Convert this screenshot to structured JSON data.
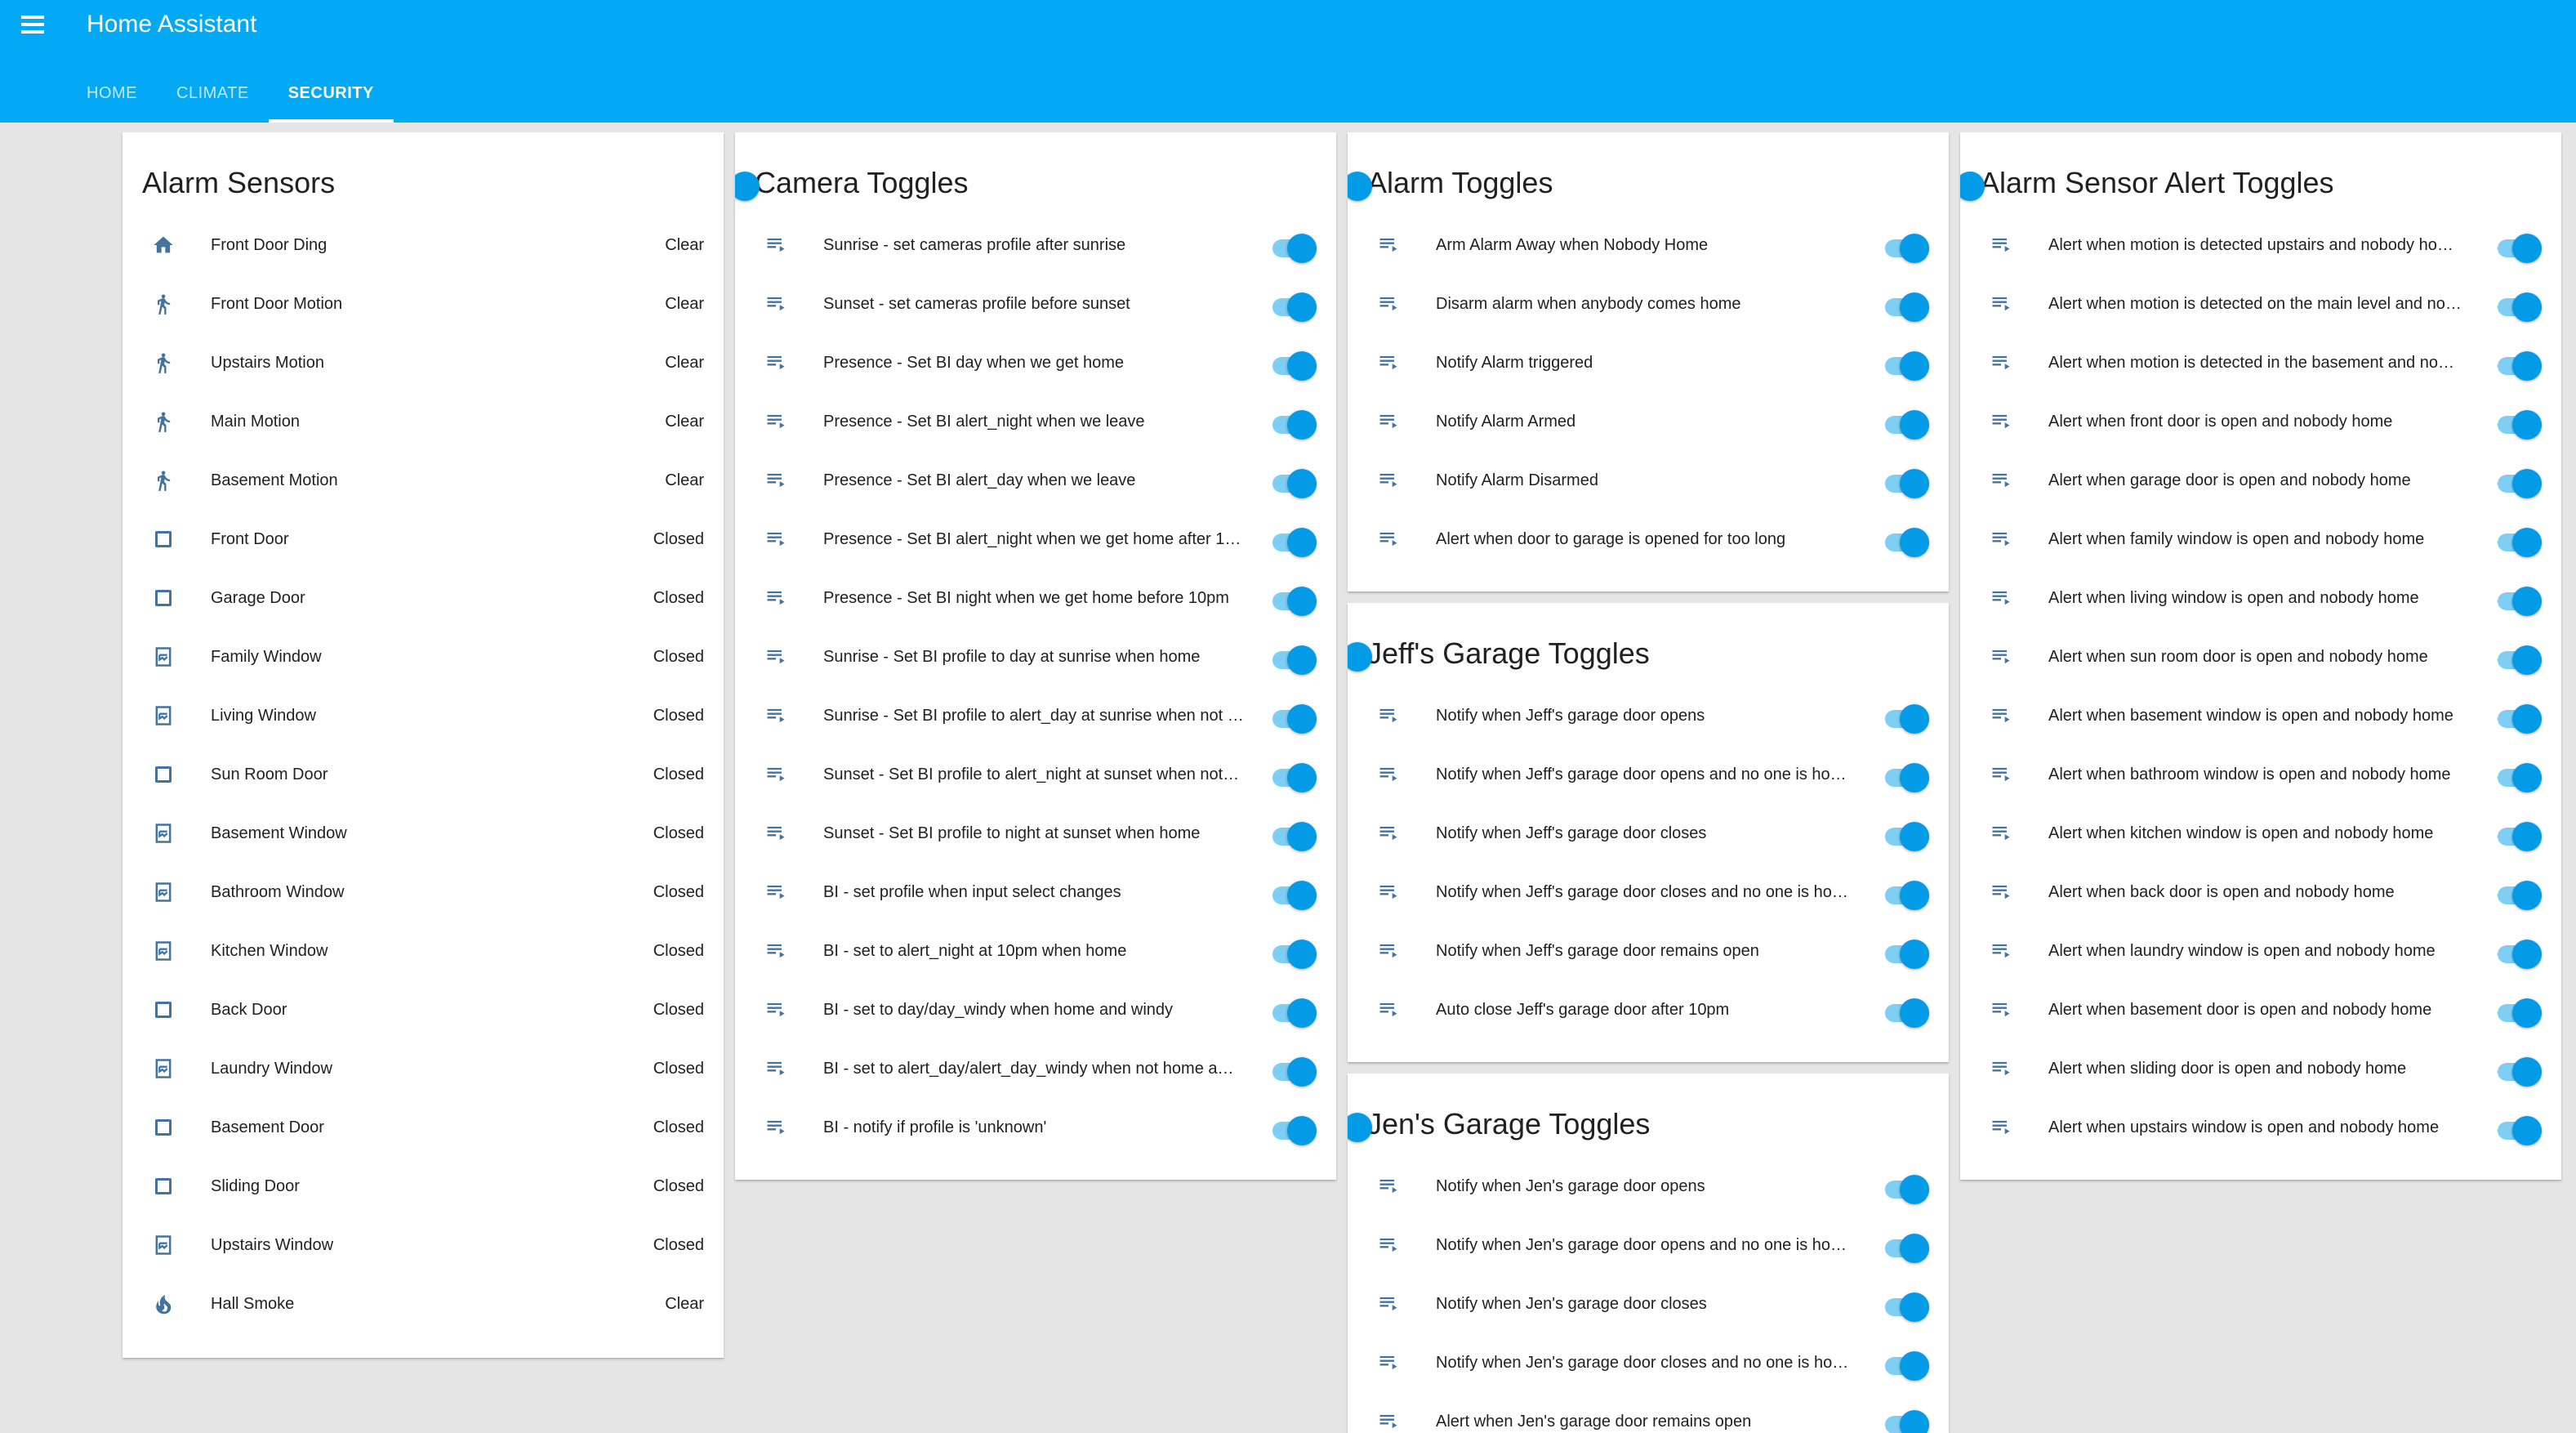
{
  "app": {
    "title": "Home Assistant"
  },
  "tabs": [
    "HOME",
    "CLIMATE",
    "SECURITY"
  ],
  "active_tab": "SECURITY",
  "colors": {
    "header": "#03a9f4",
    "icon": "#44739e",
    "toggle_on": "#039be5"
  },
  "cards": {
    "alarm_sensors": {
      "title": "Alarm Sensors",
      "rows": [
        {
          "icon": "home-icon",
          "name": "Front Door Ding",
          "state": "Clear"
        },
        {
          "icon": "walk-icon",
          "name": "Front Door Motion",
          "state": "Clear"
        },
        {
          "icon": "walk-icon",
          "name": "Upstairs Motion",
          "state": "Clear"
        },
        {
          "icon": "walk-icon",
          "name": "Main Motion",
          "state": "Clear"
        },
        {
          "icon": "walk-icon",
          "name": "Basement Motion",
          "state": "Clear"
        },
        {
          "icon": "door-checkbox-icon",
          "name": "Front Door",
          "state": "Closed"
        },
        {
          "icon": "door-checkbox-icon",
          "name": "Garage Door",
          "state": "Closed"
        },
        {
          "icon": "window-closed-icon",
          "name": "Family Window",
          "state": "Closed"
        },
        {
          "icon": "window-closed-icon",
          "name": "Living Window",
          "state": "Closed"
        },
        {
          "icon": "door-checkbox-icon",
          "name": "Sun Room Door",
          "state": "Closed"
        },
        {
          "icon": "window-closed-icon",
          "name": "Basement Window",
          "state": "Closed"
        },
        {
          "icon": "window-closed-icon",
          "name": "Bathroom Window",
          "state": "Closed"
        },
        {
          "icon": "window-closed-icon",
          "name": "Kitchen Window",
          "state": "Closed"
        },
        {
          "icon": "door-checkbox-icon",
          "name": "Back Door",
          "state": "Closed"
        },
        {
          "icon": "window-closed-icon",
          "name": "Laundry Window",
          "state": "Closed"
        },
        {
          "icon": "door-checkbox-icon",
          "name": "Basement Door",
          "state": "Closed"
        },
        {
          "icon": "door-checkbox-icon",
          "name": "Sliding Door",
          "state": "Closed"
        },
        {
          "icon": "window-closed-icon",
          "name": "Upstairs Window",
          "state": "Closed"
        },
        {
          "icon": "fire-icon",
          "name": "Hall Smoke",
          "state": "Clear"
        }
      ]
    },
    "camera_toggles": {
      "title": "Camera Toggles",
      "rows": [
        "Sunrise - set cameras profile after sunrise",
        "Sunset - set cameras profile before sunset",
        "Presence - Set BI day when we get home",
        "Presence - Set BI alert_night when we leave",
        "Presence - Set BI alert_day when we leave",
        "Presence - Set BI alert_night when we get home after 1…",
        "Presence - Set BI night when we get home before 10pm",
        "Sunrise - Set BI profile to day at sunrise when home",
        "Sunrise - Set BI profile to alert_day at sunrise when not …",
        "Sunset - Set BI profile to alert_night at sunset when not…",
        "Sunset - Set BI profile to night at sunset when home",
        "BI - set profile when input select changes",
        "BI - set to alert_night at 10pm when home",
        "BI - set to day/day_windy when home and windy",
        "BI - set to alert_day/alert_day_windy when not home a…",
        "BI - notify if profile is 'unknown'"
      ]
    },
    "alarm_toggles": {
      "title": "Alarm Toggles",
      "rows": [
        "Arm Alarm Away when Nobody Home",
        "Disarm alarm when anybody comes home",
        "Notify Alarm triggered",
        "Notify Alarm Armed",
        "Notify Alarm Disarmed",
        "Alert when door to garage is opened for too long"
      ]
    },
    "jeffs_garage_toggles": {
      "title": "Jeff's Garage Toggles",
      "rows": [
        "Notify when Jeff's garage door opens",
        "Notify when Jeff's garage door opens and no one is ho…",
        "Notify when Jeff's garage door closes",
        "Notify when Jeff's garage door closes and no one is ho…",
        "Notify when Jeff's garage door remains open",
        "Auto close Jeff's garage door after 10pm"
      ]
    },
    "jens_garage_toggles": {
      "title": "Jen's Garage Toggles",
      "rows": [
        "Notify when Jen's garage door opens",
        "Notify when Jen's garage door opens and no one is ho…",
        "Notify when Jen's garage door closes",
        "Notify when Jen's garage door closes and no one is ho…",
        "Alert when Jen's garage door remains open"
      ]
    },
    "alarm_sensor_alert_toggles": {
      "title": "Alarm Sensor Alert Toggles",
      "rows": [
        "Alert when motion is detected upstairs and nobody ho…",
        "Alert when motion is detected on the main level and no…",
        "Alert when motion is detected in the basement and no…",
        "Alert when front door is open and nobody home",
        "Alert when garage door is open and nobody home",
        "Alert when family window is open and nobody home",
        "Alert when living window is open and nobody home",
        "Alert when sun room door is open and nobody home",
        "Alert when basement window is open and nobody home",
        "Alert when bathroom window is open and nobody home",
        "Alert when kitchen window is open and nobody home",
        "Alert when back door is open and nobody home",
        "Alert when laundry window is open and nobody home",
        "Alert when basement door is open and nobody home",
        "Alert when sliding door is open and nobody home",
        "Alert when upstairs window is open and nobody home"
      ]
    }
  }
}
